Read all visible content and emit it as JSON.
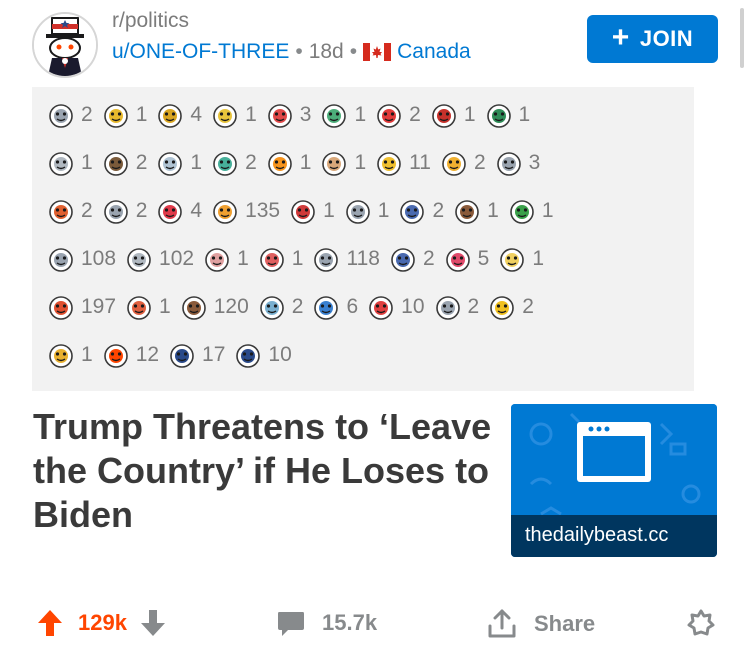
{
  "header": {
    "subreddit": "r/politics",
    "user": "u/ONE-OF-THREE",
    "age": "18d",
    "flair": "Canada",
    "join_label": "JOIN"
  },
  "awards": [
    [
      {
        "icon": "wearing-hat-snoo-icon",
        "count": "2",
        "c": "#9aa4b0"
      },
      {
        "icon": "gold-snoo-icon",
        "count": "1",
        "c": "#e8b92d"
      },
      {
        "icon": "eye-pyramid-icon",
        "count": "4",
        "c": "#d9a520"
      },
      {
        "icon": "shocked-snoo-icon",
        "count": "1",
        "c": "#e8c43c"
      },
      {
        "icon": "heart-eyes-snoo-icon",
        "count": "3",
        "c": "#e04848"
      },
      {
        "icon": "frog-icon",
        "count": "1",
        "c": "#4cae7a"
      },
      {
        "icon": "love-eyes-icon",
        "count": "2",
        "c": "#e03a3a"
      },
      {
        "icon": "heart-icon",
        "count": "1",
        "c": "#c7312b"
      },
      {
        "icon": "plus-one-icon",
        "count": "1",
        "c": "#2e8b57"
      }
    ],
    [
      {
        "icon": "pointing-hand-icon",
        "count": "1",
        "c": "#b0b8c0"
      },
      {
        "icon": "train-snoo-icon",
        "count": "2",
        "c": "#7a5a3a"
      },
      {
        "icon": "diamond-heart-icon",
        "count": "1",
        "c": "#b0c4d4"
      },
      {
        "icon": "time-clock-icon",
        "count": "2",
        "c": "#47b09a"
      },
      {
        "icon": "rainbow-icon",
        "count": "1",
        "c": "#f7941d"
      },
      {
        "icon": "thinking-snoo-icon",
        "count": "1",
        "c": "#d9a87a"
      },
      {
        "icon": "star-badge-icon",
        "count": "11",
        "c": "#f0c030"
      },
      {
        "icon": "clapping-hands-icon",
        "count": "2",
        "c": "#f0b030"
      },
      {
        "icon": "dizzy-snoo-icon",
        "count": "3",
        "c": "#9aa4b0"
      }
    ],
    [
      {
        "icon": "rocket-icon",
        "count": "2",
        "c": "#e06030"
      },
      {
        "icon": "hugging-snoo-icon",
        "count": "2",
        "c": "#9aa4b0"
      },
      {
        "icon": "heart-face-icon",
        "count": "4",
        "c": "#e03a4a"
      },
      {
        "icon": "thumbs-up-fire-icon",
        "count": "135",
        "c": "#f0a030"
      },
      {
        "icon": "gift-box-icon",
        "count": "1",
        "c": "#d03a3a"
      },
      {
        "icon": "tiny-plug-icon",
        "count": "1",
        "c": "#9aa4b0"
      },
      {
        "icon": "handshake-outline-icon",
        "count": "2",
        "c": "#4a6ab0"
      },
      {
        "icon": "cowboy-snoo-icon",
        "count": "1",
        "c": "#8a5a3a"
      },
      {
        "icon": "money-snoo-icon",
        "count": "1",
        "c": "#3aa04a"
      }
    ],
    [
      {
        "icon": "handshake-icon",
        "count": "108",
        "c": "#9aa4b0"
      },
      {
        "icon": "sleepy-face-icon",
        "count": "102",
        "c": "#b0b8c0"
      },
      {
        "icon": "cat-face-icon",
        "count": "1",
        "c": "#e0a0a0"
      },
      {
        "icon": "starstruck-snoo-icon",
        "count": "1",
        "c": "#e06060"
      },
      {
        "icon": "silver-coin-icon",
        "count": "118",
        "c": "#9aa4b0"
      },
      {
        "icon": "wizard-snoo-icon",
        "count": "2",
        "c": "#4a6ab0"
      },
      {
        "icon": "heart-eyes-face-icon",
        "count": "5",
        "c": "#e04a6a"
      },
      {
        "icon": "halo-snoo-icon",
        "count": "1",
        "c": "#f0d060"
      }
    ],
    [
      {
        "icon": "surprised-snoo-icon",
        "count": "197",
        "c": "#e05030"
      },
      {
        "icon": "laughing-face-icon",
        "count": "1",
        "c": "#e06040"
      },
      {
        "icon": "bear-icon",
        "count": "120",
        "c": "#8a5a3a"
      },
      {
        "icon": "angel-snoo-icon",
        "count": "2",
        "c": "#7ab0d0"
      },
      {
        "icon": "heart-snoo-icon",
        "count": "6",
        "c": "#3a80d0"
      },
      {
        "icon": "scared-snoo-icon",
        "count": "10",
        "c": "#e04040"
      },
      {
        "icon": "laptop-snoo-icon",
        "count": "2",
        "c": "#9aa4b0"
      },
      {
        "icon": "sunglasses-sun-icon",
        "count": "2",
        "c": "#f0c020"
      }
    ],
    [
      {
        "icon": "gold-heart-face-icon",
        "count": "1",
        "c": "#e8b030"
      },
      {
        "icon": "orange-arrow-snoo-icon",
        "count": "12",
        "c": "#ff4500"
      },
      {
        "icon": "voted-badge-icon",
        "count": "17",
        "c": "#2a4a8a"
      },
      {
        "icon": "vote-button-icon",
        "count": "10",
        "c": "#2a4a8a"
      }
    ]
  ],
  "post": {
    "title": "Trump Threatens to ‘Leave the Country’ if He Loses to Biden",
    "domain": "thedailybeast.cc"
  },
  "actions": {
    "upvotes": "129k",
    "comments": "15.7k",
    "share": "Share"
  },
  "colors": {
    "accent": "#0079d3",
    "upvote": "#ff4500",
    "muted": "#7c7c7c"
  }
}
